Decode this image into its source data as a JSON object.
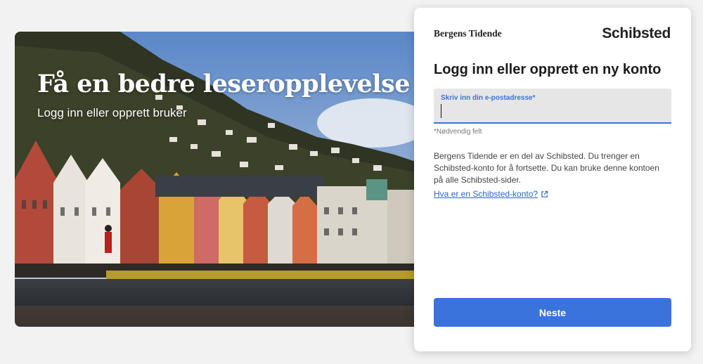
{
  "hero": {
    "title": "Få en bedre leseropplevelse",
    "subtitle": "Logg inn eller opprett bruker"
  },
  "card": {
    "brand_logo": "Bergens Tidende",
    "partner_logo": "Schibsted",
    "title": "Logg inn eller opprett en ny konto",
    "email_label": "Skriv inn din e-postadresse*",
    "email_value": "",
    "required_note": "*Nødvendig felt",
    "info_text": "Bergens Tidende er en del av Schibsted. Du trenger en Schibsted-konto for å fortsette. Du kan bruke denne kontoen på alle Schibsted-sider.",
    "info_link": "Hva er en Schibsted-konto?",
    "next_button": "Neste"
  },
  "colors": {
    "accent": "#3a73db",
    "link": "#2d63c8",
    "field_bg": "#e6e6e6"
  },
  "icons": {
    "external_link": "external-link-icon",
    "crest": "crest-icon"
  }
}
